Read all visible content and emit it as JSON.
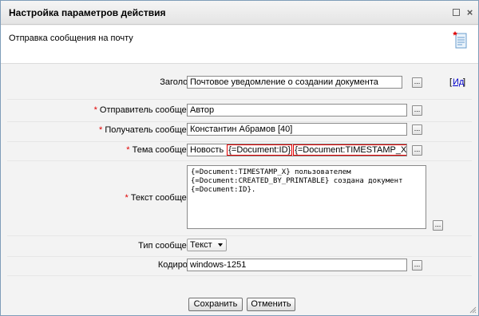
{
  "dialog": {
    "title": "Настройка параметров действия",
    "subtitle": "Отправка сообщения на почту",
    "icons": {
      "maximize": "maximize-icon",
      "close": "close-icon",
      "document": "document-icon"
    }
  },
  "form": {
    "subject": {
      "label": "Заголовок:",
      "value": "Почтовое уведомление о создании документа",
      "picker": "...",
      "link_open": "[",
      "link": "Ид",
      "link_close": "]"
    },
    "sender": {
      "required": "*",
      "label": "Отправитель сообщения:",
      "value": "Автор",
      "picker": "..."
    },
    "recipient": {
      "required": "*",
      "label": "Получатель сообщения:",
      "value": "Константин Абрамов [40]",
      "picker": "..."
    },
    "topic": {
      "required": "*",
      "label": "Тема сообщения:",
      "value_prefix": "Новость ",
      "token1": "{=Document:ID}",
      "token2": "{=Document:TIMESTAMP_X}",
      "picker": "..."
    },
    "body": {
      "required": "*",
      "label": "Текст сообщения:",
      "value": "{=Document:TIMESTAMP_X} пользователем\n{=Document:CREATED_BY_PRINTABLE} создана документ\n{=Document:ID}.",
      "picker": "..."
    },
    "message_type": {
      "label": "Тип сообщения:",
      "value": "Текст"
    },
    "encoding": {
      "label": "Кодировка:",
      "value": "windows-1251",
      "picker": "..."
    }
  },
  "buttons": {
    "save": "Сохранить",
    "cancel": "Отменить"
  },
  "colors": {
    "required": "#e00000",
    "token_border": "#e20000",
    "link": "#0000cc"
  }
}
